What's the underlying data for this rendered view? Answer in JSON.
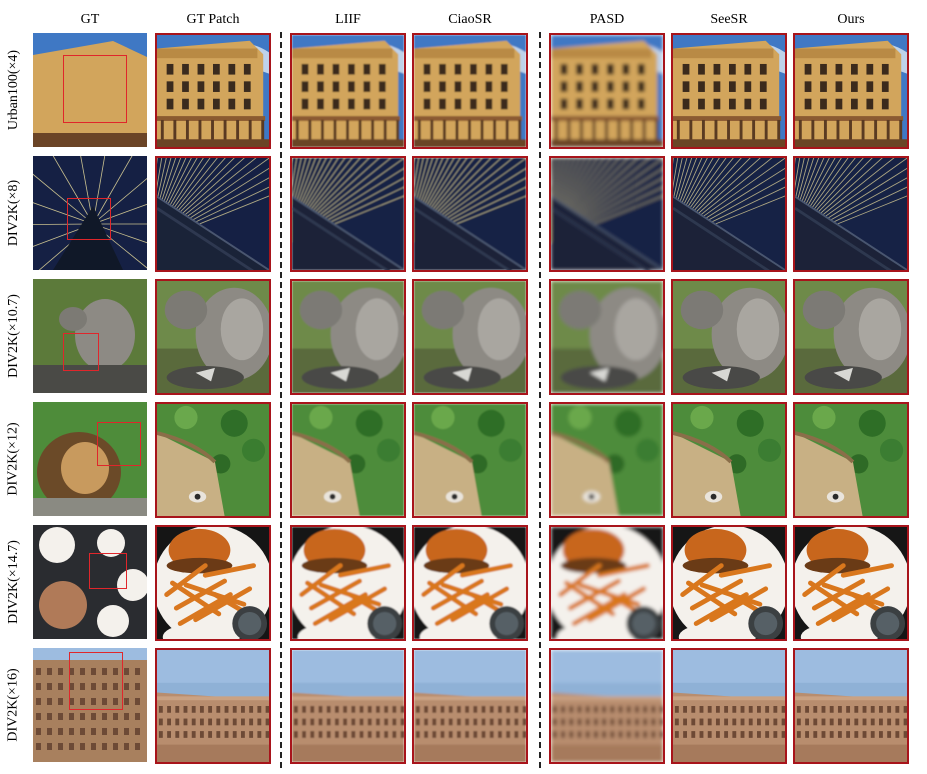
{
  "figure": {
    "columns": [
      "GT",
      "GT Patch",
      "LIIF",
      "CiaoSR",
      "PASD",
      "SeeSR",
      "Ours"
    ],
    "rows": [
      {
        "label": "Urban100(×4)",
        "scene": "building"
      },
      {
        "label": "DIV2K(×8)",
        "scene": "rays"
      },
      {
        "label": "DIV2K(×10.7)",
        "scene": "squirrel"
      },
      {
        "label": "DIV2K(×12)",
        "scene": "lion"
      },
      {
        "label": "DIV2K(×14.7)",
        "scene": "food"
      },
      {
        "label": "DIV2K(×16)",
        "scene": "colosseum"
      }
    ],
    "patch_border_color": "#a8141b",
    "gt_box_color": "#e0262b"
  }
}
